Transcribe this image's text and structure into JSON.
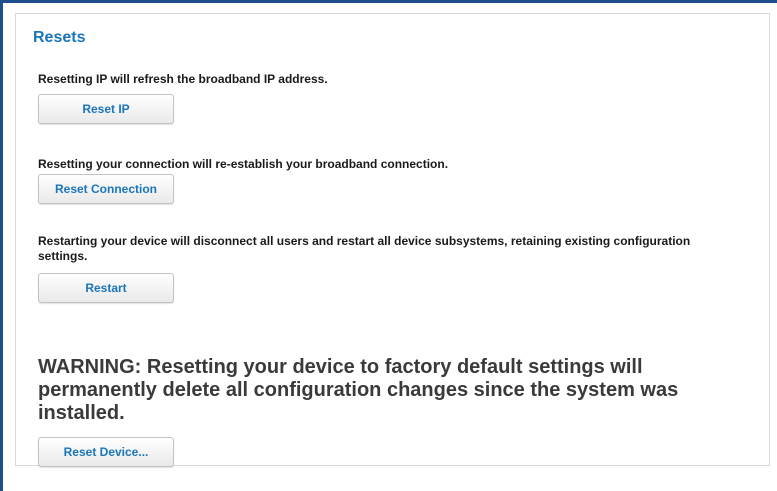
{
  "section": {
    "title": "Resets"
  },
  "reset_ip": {
    "description": "Resetting IP will refresh the broadband IP address.",
    "button_label": "Reset IP"
  },
  "reset_connection": {
    "description": "Resetting your connection will re-establish your broadband connection.",
    "button_label": "Reset Connection"
  },
  "restart": {
    "description": "Restarting your device will disconnect all users and restart all device subsystems, retaining existing configuration settings.",
    "button_label": "Restart"
  },
  "factory_reset": {
    "warning": "WARNING: Resetting your device to factory default settings will permanently delete all configuration changes since the system was installed.",
    "button_label": "Reset Device..."
  },
  "colors": {
    "accent": "#1b75bb",
    "frame": "#1f4f8f",
    "warning_text": "#3a3a3a"
  }
}
